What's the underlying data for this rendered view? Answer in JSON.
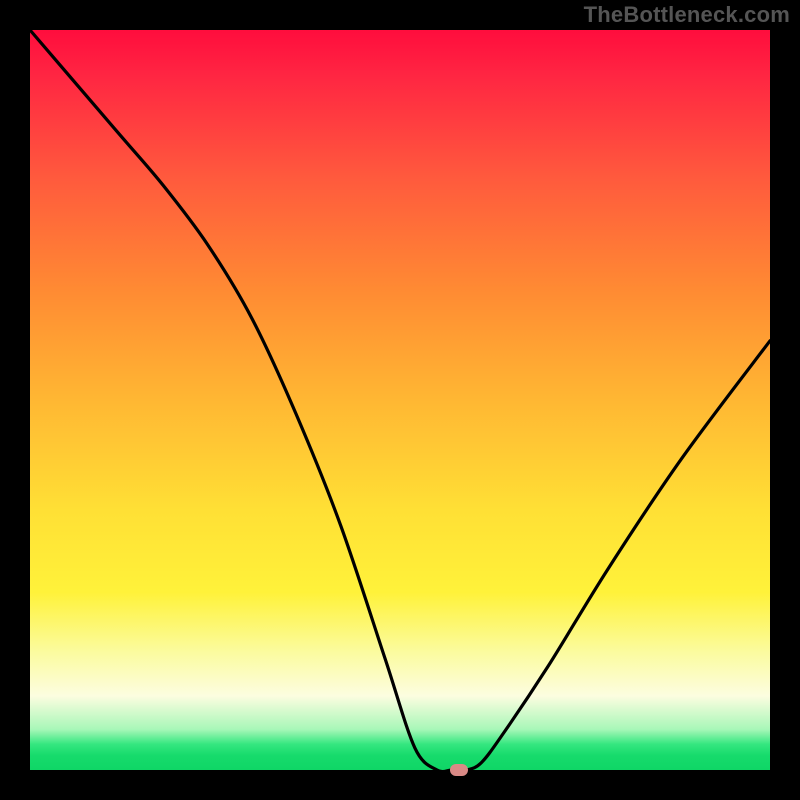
{
  "watermark": "TheBottleneck.com",
  "colors": {
    "frame": "#000000",
    "watermark": "#555555",
    "curve": "#000000",
    "marker": "#d98a86",
    "gradient_top": "#ff0d3d",
    "gradient_mid": "#ffe035",
    "gradient_bottom": "#0fd666"
  },
  "chart_data": {
    "type": "line",
    "title": "",
    "xlabel": "",
    "ylabel": "",
    "xlim": [
      0,
      100
    ],
    "ylim": [
      0,
      100
    ],
    "grid": false,
    "legend": false,
    "annotations": [],
    "series": [
      {
        "name": "bottleneck-curve",
        "x": [
          0,
          6,
          12,
          18,
          24,
          30,
          36,
          42,
          48,
          52,
          55,
          57,
          59,
          61,
          64,
          70,
          78,
          88,
          100
        ],
        "y": [
          100,
          93,
          86,
          79,
          71,
          61,
          48,
          33,
          15,
          3,
          0,
          0,
          0,
          1,
          5,
          14,
          27,
          42,
          58
        ]
      }
    ],
    "marker": {
      "x": 58,
      "y": 0
    }
  }
}
